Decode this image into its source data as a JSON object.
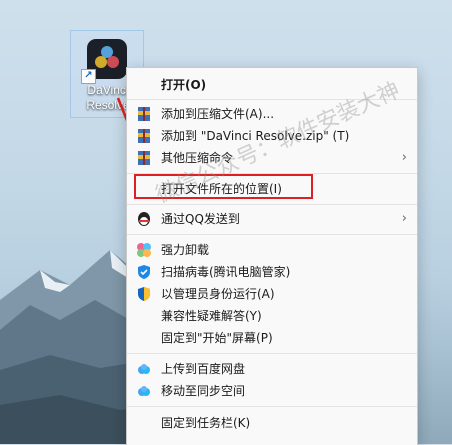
{
  "desktop": {
    "icon_label_line1": "DaVinci",
    "icon_label_line2": "Resolve",
    "icon_name": "davinci-resolve-icon"
  },
  "menu": {
    "items": [
      {
        "label": "打开(O)",
        "bold": true
      },
      {
        "label": "添加到压缩文件(A)...",
        "icon": "archive-icon"
      },
      {
        "label": "添加到 \"DaVinci Resolve.zip\" (T)",
        "icon": "archive-icon"
      },
      {
        "label": "其他压缩命令",
        "icon": "archive-icon",
        "submenu": true
      },
      {
        "label": "打开文件所在的位置(I)"
      },
      {
        "label": "通过QQ发送到",
        "icon": "qq-icon",
        "submenu": true
      },
      {
        "label": "强力卸载",
        "icon": "uninstall-icon"
      },
      {
        "label": "扫描病毒(腾讯电脑管家)",
        "icon": "shield-icon"
      },
      {
        "label": "以管理员身份运行(A)",
        "icon": "admin-shield-icon"
      },
      {
        "label": "兼容性疑难解答(Y)"
      },
      {
        "label": "固定到\"开始\"屏幕(P)"
      },
      {
        "label": "上传到百度网盘",
        "icon": "cloud-icon"
      },
      {
        "label": "移动至同步空间",
        "icon": "cloud-icon"
      },
      {
        "label": "固定到任务栏(K)"
      }
    ]
  },
  "watermark": "微信公众号：软件安装大神",
  "colors": {
    "highlight": "#e02020",
    "menu_bg": "#f9f9f9"
  }
}
